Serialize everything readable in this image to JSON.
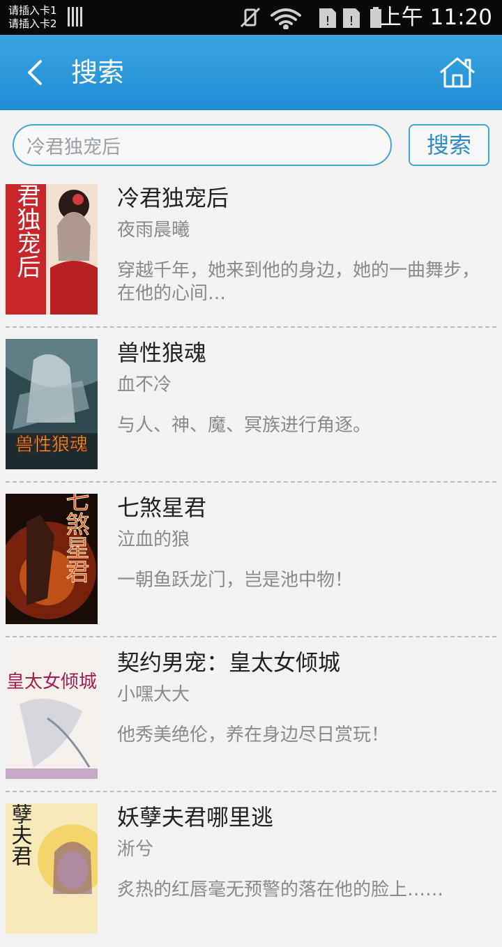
{
  "status_bar": {
    "sim1": "请插入卡1",
    "sim2": "请插入卡2",
    "time": "上午 11:20"
  },
  "header": {
    "title": "搜索",
    "back_icon": "chevron-left-icon",
    "home_icon": "home-icon",
    "background": "#2196d9"
  },
  "search": {
    "value": "冷君独宠后",
    "button_label": "搜索",
    "accent": "#42a3d4"
  },
  "books": [
    {
      "title": "冷君独宠后",
      "author": "夜雨晨曦",
      "description": "穿越千年，她来到他的身边，她的一曲舞步，在他的心间…",
      "cover_text": "冷君独宠后"
    },
    {
      "title": "兽性狼魂",
      "author": "血不冷",
      "description": "与人、神、魔、冥族进行角逐。",
      "cover_text": "兽性狼魂"
    },
    {
      "title": "七煞星君",
      "author": "泣血的狼",
      "description": "一朝鱼跃龙门，岂是池中物！",
      "cover_text": "七煞星君"
    },
    {
      "title": "契约男宠：皇太女倾城",
      "author": "小嘿大大",
      "description": "他秀美绝伦，养在身边尽日赏玩！",
      "cover_text": "皇太女倾城"
    },
    {
      "title": "妖孽夫君哪里逃",
      "author": "淅兮",
      "description": "炙热的红唇毫无预警的落在他的脸上……",
      "cover_text": "妖孽夫君"
    }
  ]
}
